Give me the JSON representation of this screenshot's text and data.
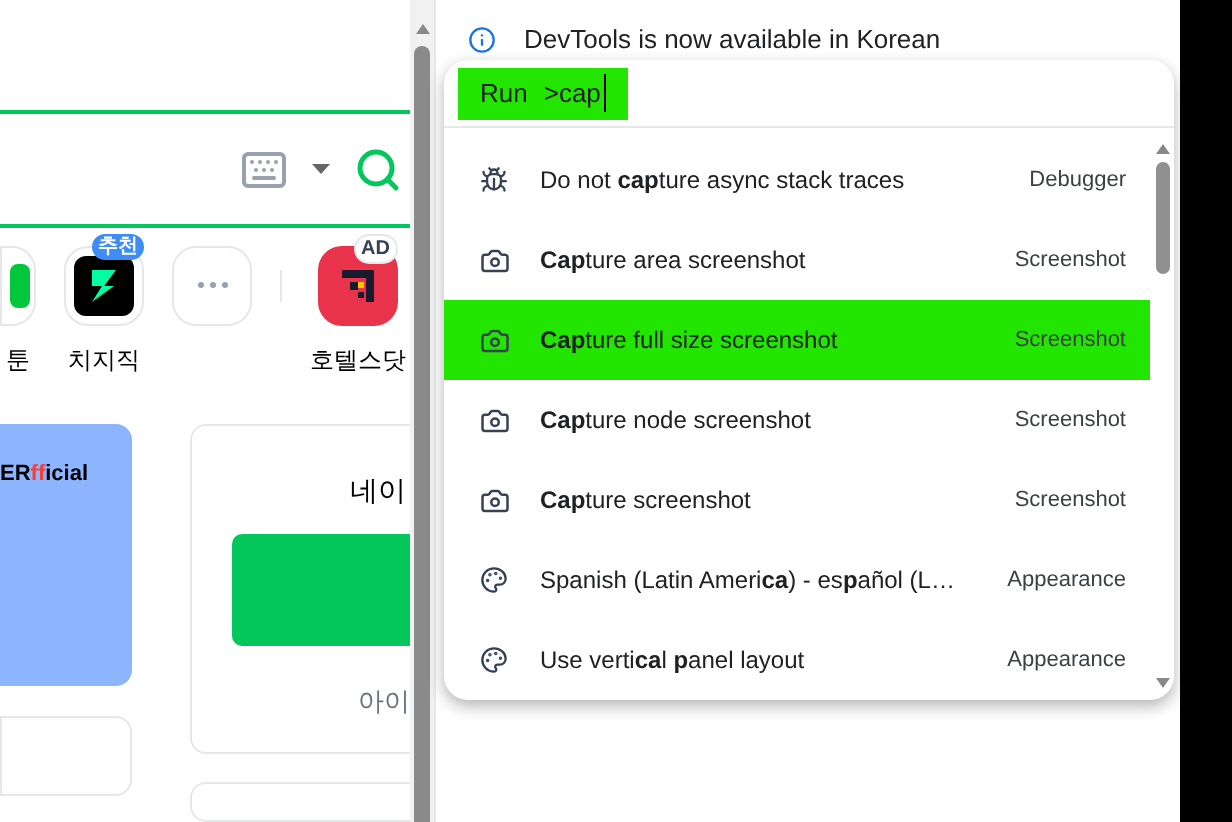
{
  "page": {
    "shortcuts": [
      {
        "label": "툰",
        "kind": "webtoon"
      },
      {
        "label": "치지직",
        "kind": "chzzk",
        "badge": "추천"
      },
      {
        "kind": "more"
      },
      {
        "label": "호텔스닷",
        "kind": "hotel",
        "badge": "AD"
      }
    ],
    "promo_card": {
      "prefix": "ER",
      "accent": "ff",
      "suffix": "icial"
    },
    "login_card": {
      "title": "네이",
      "link": "아이"
    }
  },
  "devtools": {
    "notice": "DevTools is now available in Korean",
    "command_menu": {
      "prompt": "Run",
      "query": ">cap",
      "highlighted": true,
      "items": [
        {
          "title": "Do not **cap**ture async stack traces",
          "category": "Debugger",
          "kind": "debugger",
          "selected": false
        },
        {
          "title": "**Cap**ture area screenshot",
          "category": "Screenshot",
          "kind": "screenshot",
          "selected": false
        },
        {
          "title": "**Cap**ture full size screenshot",
          "category": "Screenshot",
          "kind": "screenshot",
          "selected": true
        },
        {
          "title": "**Cap**ture node screenshot",
          "category": "Screenshot",
          "kind": "screenshot",
          "selected": false
        },
        {
          "title": "**Cap**ture screenshot",
          "category": "Screenshot",
          "kind": "screenshot",
          "selected": false
        },
        {
          "title": "Spanish (Latin Ameri**ca**) - es**p**añol (L…",
          "category": "Appearance",
          "kind": "appearance",
          "selected": false
        },
        {
          "title": "Use verti**ca**l **p**anel layout",
          "category": "Appearance",
          "kind": "appearance",
          "selected": false
        }
      ]
    }
  }
}
